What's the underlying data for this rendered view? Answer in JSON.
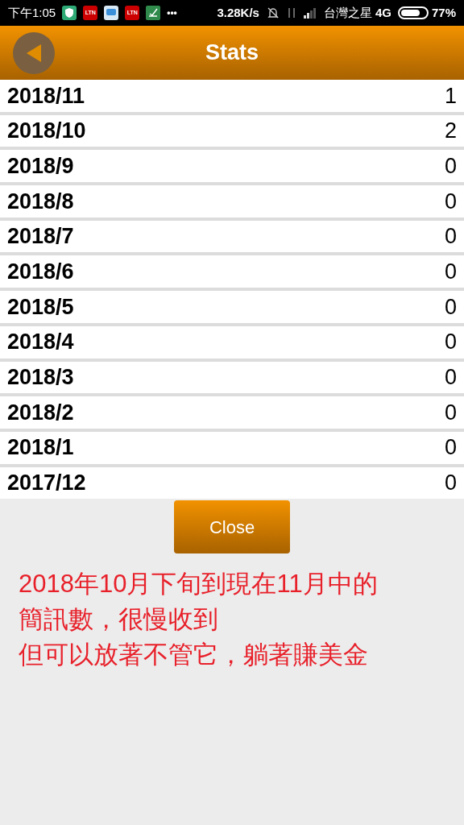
{
  "status_bar": {
    "time": "下午1:05",
    "app_badges": [
      "LTN",
      "LTN"
    ],
    "more": "•••",
    "speed": "3.28K/s",
    "carrier": "台灣之星",
    "network": "4G",
    "battery": {
      "percent": "77%"
    }
  },
  "header": {
    "title": "Stats"
  },
  "rows": [
    {
      "month": "2018/11",
      "count": "1"
    },
    {
      "month": "2018/10",
      "count": "2"
    },
    {
      "month": "2018/9",
      "count": "0"
    },
    {
      "month": "2018/8",
      "count": "0"
    },
    {
      "month": "2018/7",
      "count": "0"
    },
    {
      "month": "2018/6",
      "count": "0"
    },
    {
      "month": "2018/5",
      "count": "0"
    },
    {
      "month": "2018/4",
      "count": "0"
    },
    {
      "month": "2018/3",
      "count": "0"
    },
    {
      "month": "2018/2",
      "count": "0"
    },
    {
      "month": "2018/1",
      "count": "0"
    },
    {
      "month": "2017/12",
      "count": "0"
    }
  ],
  "close_button": "Close",
  "note": [
    "2018年10月下旬到現在11月中的",
    "簡訊數，很慢收到",
    "但可以放著不管它，躺著賺美金"
  ]
}
